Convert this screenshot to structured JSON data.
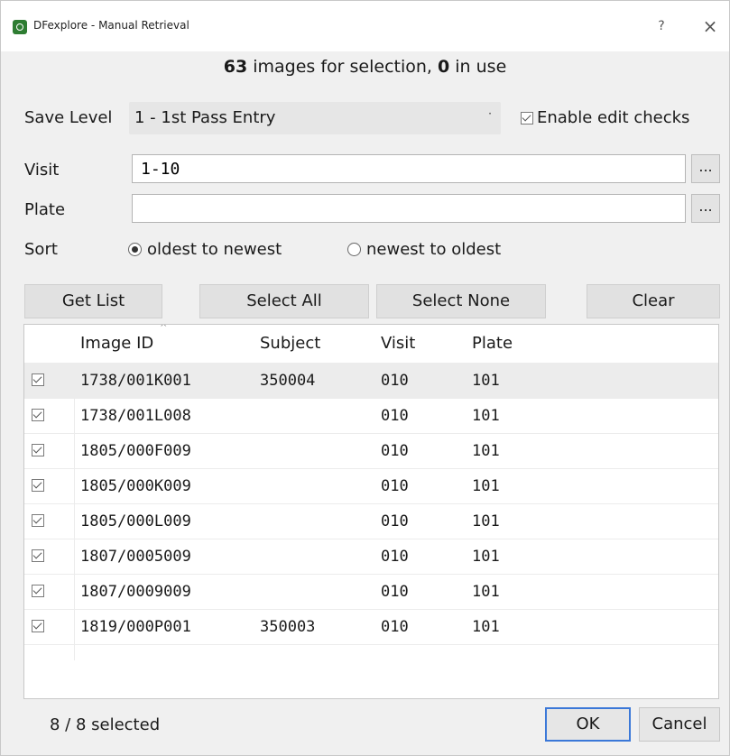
{
  "window": {
    "title": "DFexplore - Manual Retrieval",
    "help": "?",
    "close": "×"
  },
  "status": {
    "images_count": "63",
    "images_suffix": " images for selection, ",
    "in_use_count": "0",
    "in_use_suffix": " in use"
  },
  "save_level": {
    "label": "Save Level",
    "value": "1 - 1st Pass Entry",
    "arrow": "·"
  },
  "edit_checks": {
    "label": "Enable edit checks",
    "checked": true
  },
  "visit": {
    "label": "Visit",
    "value": "1-10",
    "button": "..."
  },
  "plate": {
    "label": "Plate",
    "value": "",
    "button": "..."
  },
  "sort": {
    "label": "Sort",
    "options": [
      {
        "label": "oldest to newest",
        "selected": true
      },
      {
        "label": "newest to oldest",
        "selected": false
      }
    ]
  },
  "buttons": {
    "get_list": "Get List",
    "select_all": "Select All",
    "select_none": "Select None",
    "clear": "Clear"
  },
  "table": {
    "columns": [
      "Image ID",
      "Subject",
      "Visit",
      "Plate"
    ],
    "rows": [
      {
        "image_id": "1738/001K001",
        "subject": "350004",
        "visit": "010",
        "plate": "101"
      },
      {
        "image_id": "1738/001L008",
        "subject": "",
        "visit": "010",
        "plate": "101"
      },
      {
        "image_id": "1805/000F009",
        "subject": "",
        "visit": "010",
        "plate": "101"
      },
      {
        "image_id": "1805/000K009",
        "subject": "",
        "visit": "010",
        "plate": "101"
      },
      {
        "image_id": "1805/000L009",
        "subject": "",
        "visit": "010",
        "plate": "101"
      },
      {
        "image_id": "1807/0005009",
        "subject": "",
        "visit": "010",
        "plate": "101"
      },
      {
        "image_id": "1807/0009009",
        "subject": "",
        "visit": "010",
        "plate": "101"
      },
      {
        "image_id": "1819/000P001",
        "subject": "350003",
        "visit": "010",
        "plate": "101"
      }
    ]
  },
  "footer": {
    "selected": "8 / 8 selected",
    "ok": "OK",
    "cancel": "Cancel"
  }
}
